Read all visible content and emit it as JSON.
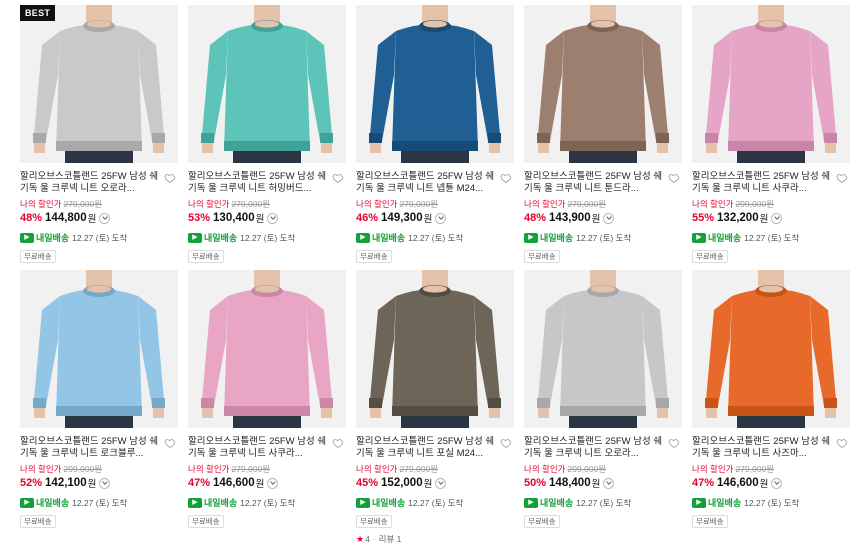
{
  "products": [
    {
      "badge": "BEST",
      "title": "할리오브스코틀랜드 25FW 남성 쉐기독 울 크루넥 니트 오로라...",
      "my_price_label": "나의 할인가",
      "orig_price": "279,000원",
      "discount": "48%",
      "price": "144,800",
      "won": "원",
      "delivery_label": "내일배송",
      "delivery_date": "12.27 (토) 도착",
      "free_ship": "무료배송",
      "color": "#c9c9c9",
      "color_dark": "#a9a9a9"
    },
    {
      "title": "할리오브스코틀랜드 25FW 남성 쉐기독 울 크루넥 니트 허밍버드...",
      "my_price_label": "나의 할인가",
      "orig_price": "279,000원",
      "discount": "53%",
      "price": "130,400",
      "won": "원",
      "delivery_label": "내일배송",
      "delivery_date": "12.27 (토) 도착",
      "free_ship": "무료배송",
      "color": "#5cc4b8",
      "color_dark": "#3fa497"
    },
    {
      "title": "할리오브스코틀랜드 25FW 남성 쉐기독 울 크루넥 니트 넵튠 M24...",
      "my_price_label": "나의 할인가",
      "orig_price": "279,000원",
      "discount": "46%",
      "price": "149,300",
      "won": "원",
      "delivery_label": "내일배송",
      "delivery_date": "12.27 (토) 도착",
      "free_ship": "무료배송",
      "color": "#1f5f94",
      "color_dark": "#174a75"
    },
    {
      "title": "할리오브스코틀랜드 25FW 남성 쉐기독 울 크루넥 니트 툰드라...",
      "my_price_label": "나의 할인가",
      "orig_price": "279,000원",
      "discount": "48%",
      "price": "143,900",
      "won": "원",
      "delivery_label": "내일배송",
      "delivery_date": "12.27 (토) 도착",
      "free_ship": "무료배송",
      "color": "#9c7f6f",
      "color_dark": "#7e6455"
    },
    {
      "title": "할리오브스코틀랜드 25FW 남성 쉐기독 울 크루넥 니트 사쿠라...",
      "my_price_label": "나의 할인가",
      "orig_price": "299,000원",
      "discount": "55%",
      "price": "132,200",
      "won": "원",
      "delivery_label": "내일배송",
      "delivery_date": "12.27 (토) 도착",
      "free_ship": "무료배송",
      "color": "#e6a4c6",
      "color_dark": "#c985a8"
    },
    {
      "title": "할리오브스코틀랜드 25FW 남성 쉐기독 울 크루넥 니트 로크블루...",
      "my_price_label": "나의 할인가",
      "orig_price": "299,000원",
      "discount": "52%",
      "price": "142,100",
      "won": "원",
      "delivery_label": "내일배송",
      "delivery_date": "12.27 (토) 도착",
      "free_ship": "무료배송",
      "color": "#93c6e6",
      "color_dark": "#74a9ca"
    },
    {
      "title": "할리오브스코틀랜드 25FW 남성 쉐기독 울 크루넥 니트 사쿠라...",
      "my_price_label": "나의 할인가",
      "orig_price": "279,000원",
      "discount": "47%",
      "price": "146,600",
      "won": "원",
      "delivery_label": "내일배송",
      "delivery_date": "12.27 (토) 도착",
      "free_ship": "무료배송",
      "color": "#e8a5c4",
      "color_dark": "#cc87a6"
    },
    {
      "title": "할리오브스코틀랜드 25FW 남성 쉐기독 울 크루넥 니트 포실 M24...",
      "my_price_label": "나의 할인가",
      "orig_price": "279,000원",
      "discount": "45%",
      "price": "152,000",
      "won": "원",
      "delivery_label": "내일배송",
      "delivery_date": "12.27 (토) 도착",
      "free_ship": "무료배송",
      "rating": "4",
      "reviews": "리뷰 1",
      "color": "#6d6658",
      "color_dark": "#544e42"
    },
    {
      "title": "할리오브스코틀랜드 25FW 남성 쉐기독 울 크루넥 니트 오로라...",
      "my_price_label": "나의 할인가",
      "orig_price": "299,000원",
      "discount": "50%",
      "price": "148,400",
      "won": "원",
      "delivery_label": "내일배송",
      "delivery_date": "12.27 (토) 도착",
      "free_ship": "무료배송",
      "color": "#c7c7c9",
      "color_dark": "#a8a8ab"
    },
    {
      "title": "할리오브스코틀랜드 25FW 남성 쉐기독 울 크루넥 니트 사즈마...",
      "my_price_label": "나의 할인가",
      "orig_price": "279,000원",
      "discount": "47%",
      "price": "146,600",
      "won": "원",
      "delivery_label": "내일배송",
      "delivery_date": "12.27 (토) 도착",
      "free_ship": "무료배송",
      "color": "#e86a2a",
      "color_dark": "#c85418"
    }
  ]
}
